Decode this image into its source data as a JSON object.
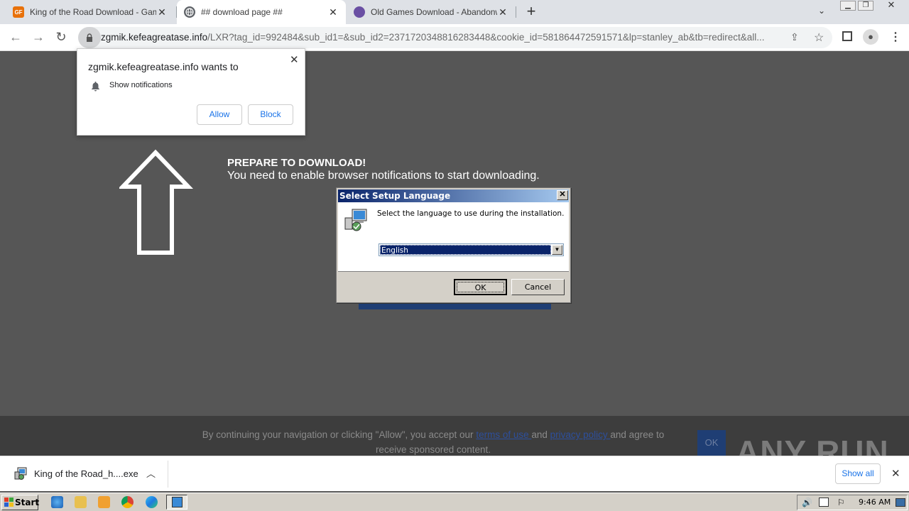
{
  "browser": {
    "tabs": [
      {
        "label": "King of the Road Download - GameF",
        "favicon": "gamefabrique-icon",
        "color": "#e8710a"
      },
      {
        "label": "## download page ##",
        "favicon": "globe-icon",
        "active": true
      },
      {
        "label": "Old Games Download - Abandonware",
        "favicon": "abandonware-icon",
        "color": "#6a4fa3"
      }
    ],
    "new_tab": "+",
    "url_host": "zgmik.kefeagreatase.info",
    "url_rest": "/LXR?tag_id=992484&sub_id1=&sub_id2=2371720348816283448&cookie_id=581864472591571&lp=stanley_ab&tb=redirect&all..."
  },
  "notification_prompt": {
    "title": "zgmik.kefeagreatase.info wants to",
    "permission": "Show notifications",
    "allow_label": "Allow",
    "block_label": "Block"
  },
  "page": {
    "headline": "PREPARE TO DOWNLOAD!",
    "subline": "You need to enable browser notifications to start downloading.",
    "consent_before": "By continuing your navigation or clicking \"Allow\", you accept our ",
    "terms_link": "terms of use ",
    "consent_mid": "and ",
    "privacy_link": "privacy policy ",
    "consent_after": "and agree to receive sponsored content.",
    "ok_label": "OK",
    "watermark": "ANY RUN"
  },
  "setup_dialog": {
    "title": "Select Setup Language",
    "message": "Select the language to use during the installation.",
    "selected_language": "English",
    "ok_label": "OK",
    "cancel_label": "Cancel"
  },
  "download_bar": {
    "file_name": "King of the Road_h....exe",
    "show_all_label": "Show all"
  },
  "taskbar": {
    "start_label": "Start",
    "clock": "9:46 AM"
  }
}
